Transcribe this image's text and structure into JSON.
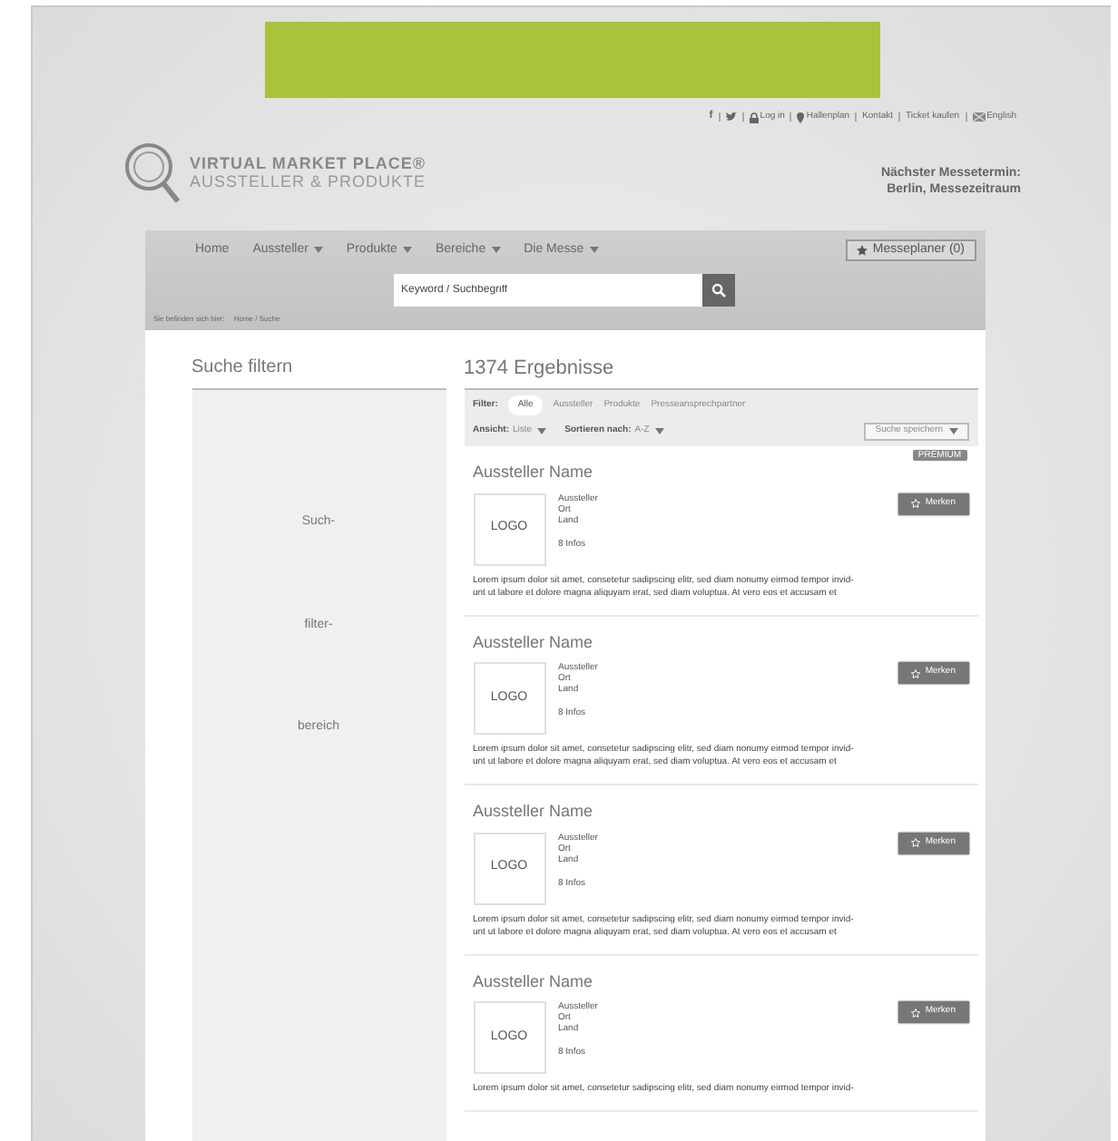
{
  "top_links": [
    {
      "kind": "facebook",
      "label": "f"
    },
    {
      "kind": "twitter"
    },
    {
      "kind": "login",
      "label": "Log in"
    },
    {
      "kind": "pin",
      "label": "Hallenplan"
    },
    {
      "kind": "text",
      "label": "Kontakt"
    },
    {
      "kind": "text",
      "label": "Ticket kaufen"
    },
    {
      "kind": "language",
      "label": "English"
    }
  ],
  "logo": {
    "title": "VIRTUAL MARKET PLACE®",
    "subtitle": "AUSSTELLER & PRODUKTE"
  },
  "next_event": {
    "label": "Nächster Messetermin:",
    "value": "Berlin, Messezeitraum"
  },
  "nav": {
    "items": [
      {
        "label": "Home",
        "dropdown": false
      },
      {
        "label": "Aussteller",
        "dropdown": true
      },
      {
        "label": "Produkte",
        "dropdown": true
      },
      {
        "label": "Bereiche",
        "dropdown": true
      },
      {
        "label": "Die Messe",
        "dropdown": true
      }
    ],
    "planner": "Messeplaner (0)"
  },
  "search": {
    "placeholder": "Keyword / Suchbegriff"
  },
  "breadcrumb": {
    "label": "Sie befinden sich hier:",
    "path": "Home / Suche"
  },
  "sidebar": {
    "title": "Suche filtern",
    "lines": [
      "Such-",
      "filter-",
      "bereich"
    ]
  },
  "results": {
    "title": "1374 Ergebnisse",
    "filter_label": "Filter:",
    "filters": [
      {
        "label": "Alle",
        "selected": true
      },
      {
        "label": "Aussteller",
        "selected": false
      },
      {
        "label": "Produkte",
        "selected": false
      },
      {
        "label": "Presseansprechpartner",
        "selected": false
      }
    ],
    "view": {
      "label": "Ansicht:",
      "value": "Liste"
    },
    "sort": {
      "label": "Sortieren nach:",
      "value": "A-Z"
    },
    "save": "Suche speichern",
    "items": [
      {
        "badge": "PREMIUM",
        "name": "Aussteller Name",
        "logo": "LOGO",
        "details": [
          "Aussteller",
          "Ort",
          "Land"
        ],
        "info": "8 Infos",
        "button": "Merken",
        "description": [
          "Lorem ipsum dolor sit amet, consetetur sadipscing elitr, sed diam nonumy eirmod tempor invid-",
          "unt ut labore et dolore magna aliquyam erat, sed diam voluptua. At vero eos et accusam et"
        ]
      },
      {
        "name": "Aussteller Name",
        "logo": "LOGO",
        "details": [
          "Aussteller",
          "Ort",
          "Land"
        ],
        "info": "8 Infos",
        "button": "Merken",
        "description": [
          "Lorem ipsum dolor sit amet, consetetur sadipscing elitr, sed diam nonumy eirmod tempor invid-",
          "unt ut labore et dolore magna aliquyam erat, sed diam voluptua. At vero eos et accusam et"
        ]
      },
      {
        "name": "Aussteller Name",
        "logo": "LOGO",
        "details": [
          "Aussteller",
          "Ort",
          "Land"
        ],
        "info": "8 Infos",
        "button": "Merken",
        "description": [
          "Lorem ipsum dolor sit amet, consetetur sadipscing elitr, sed diam nonumy eirmod tempor invid-",
          "unt ut labore et dolore magna aliquyam erat, sed diam voluptua. At vero eos et accusam et"
        ]
      },
      {
        "name": "Aussteller Name",
        "logo": "LOGO",
        "details": [
          "Aussteller",
          "Ort",
          "Land"
        ],
        "info": "8 Infos",
        "button": "Merken",
        "description": [
          "Lorem ipsum dolor sit amet, consetetur sadipscing elitr, sed diam nonumy eirmod tempor invid-"
        ]
      }
    ]
  }
}
